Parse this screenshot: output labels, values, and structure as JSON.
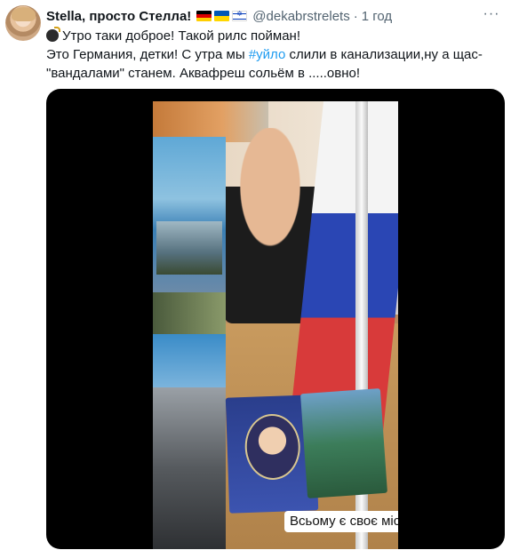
{
  "tweet": {
    "display_name": "Stella, просто Стелла!",
    "flags": [
      "flag-germany-icon",
      "flag-ukraine-icon",
      "flag-israel-icon"
    ],
    "handle": "@dekabrstrelets",
    "separator": "·",
    "time": "1 год",
    "more_label": "···",
    "text": {
      "line1": "Утро таки доброе! Такой рилс пойман!",
      "line2_prefix": "Это Германия, детки! С утра мы ",
      "hashtag": "#уйло",
      "line2_suffix": " слили в канализации,ну а щас-",
      "line3": "\"вандалами\" станем. Аквафреш сольём в .....овно!"
    },
    "media": {
      "caption": "Всьому є своє місце",
      "caption_icon": "smiling-face-icon"
    }
  }
}
